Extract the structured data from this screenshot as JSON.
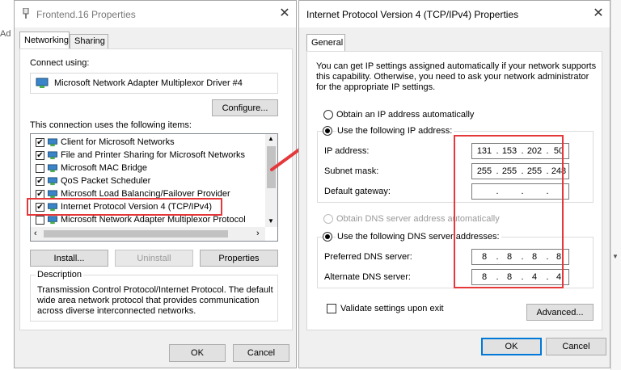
{
  "background": {
    "fragment": "Ad"
  },
  "left_dialog": {
    "title": "Frontend.16 Properties",
    "tabs": [
      "Networking",
      "Sharing"
    ],
    "connect_using_label": "Connect using:",
    "adapter_name": "Microsoft Network Adapter Multiplexor Driver #4",
    "configure_button": "Configure...",
    "items_label": "This connection uses the following items:",
    "items": [
      {
        "label": "Client for Microsoft Networks",
        "checked": true
      },
      {
        "label": "File and Printer Sharing for Microsoft Networks",
        "checked": true
      },
      {
        "label": "Microsoft MAC Bridge",
        "checked": false
      },
      {
        "label": "QoS Packet Scheduler",
        "checked": true
      },
      {
        "label": "Microsoft Load Balancing/Failover Provider",
        "checked": true
      },
      {
        "label": "Internet Protocol Version 4 (TCP/IPv4)",
        "checked": true
      },
      {
        "label": "Microsoft Network Adapter Multiplexor Protocol",
        "checked": false
      }
    ],
    "install_button": "Install...",
    "uninstall_button": "Uninstall",
    "properties_button": "Properties",
    "description_label": "Description",
    "description_lines": [
      "Transmission Control Protocol/Internet Protocol. The default",
      "wide area network protocol that provides communication",
      "across diverse interconnected networks."
    ],
    "ok_button": "OK",
    "cancel_button": "Cancel"
  },
  "right_dialog": {
    "title": "Internet Protocol Version 4 (TCP/IPv4) Properties",
    "tab": "General",
    "intro_lines": [
      "You can get IP settings assigned automatically if your network supports",
      "this capability. Otherwise, you need to ask your network administrator",
      "for the appropriate IP settings."
    ],
    "obtain_ip_auto": "Obtain an IP address automatically",
    "use_following_ip": "Use the following IP address:",
    "ip_address_label": "IP address:",
    "ip_address": [
      "131",
      "153",
      "202",
      "50"
    ],
    "subnet_mask_label": "Subnet mask:",
    "subnet_mask": [
      "255",
      "255",
      "255",
      "248"
    ],
    "default_gateway_label": "Default gateway:",
    "default_gateway": [
      "",
      "",
      "",
      ""
    ],
    "obtain_dns_auto": "Obtain DNS server address automatically",
    "use_following_dns": "Use the following DNS server addresses:",
    "preferred_dns_label": "Preferred DNS server:",
    "preferred_dns": [
      "8",
      "8",
      "8",
      "8"
    ],
    "alternate_dns_label": "Alternate DNS server:",
    "alternate_dns": [
      "8",
      "8",
      "4",
      "4"
    ],
    "validate_label": "Validate settings upon exit",
    "advanced_button": "Advanced...",
    "ok_button": "OK",
    "cancel_button": "Cancel"
  },
  "colors": {
    "highlight": "#e5383b",
    "arrow": "#e5383b",
    "focus": "#0078d7"
  }
}
